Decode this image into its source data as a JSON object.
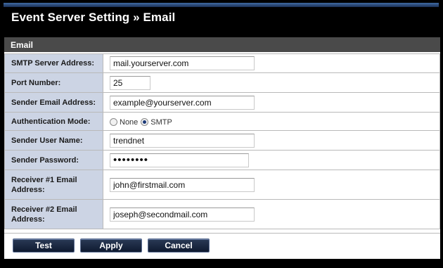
{
  "page": {
    "title": "Event Server Setting » Email"
  },
  "section": {
    "heading": "Email"
  },
  "fields": {
    "smtp_server": {
      "label": "SMTP Server Address:",
      "value": "mail.yourserver.com"
    },
    "port": {
      "label": "Port Number:",
      "value": "25"
    },
    "sender_email": {
      "label": "Sender Email Address:",
      "value": "example@yourserver.com"
    },
    "auth_mode": {
      "label": "Authentication Mode:",
      "options": [
        "None",
        "SMTP"
      ],
      "selected": "SMTP"
    },
    "sender_user": {
      "label": "Sender User Name:",
      "value": "trendnet"
    },
    "sender_password": {
      "label": "Sender Password:",
      "value": "••••••••"
    },
    "receiver1": {
      "label": "Receiver #1 Email Address:",
      "value": "john@firstmail.com"
    },
    "receiver2": {
      "label": "Receiver #2 Email Address:",
      "value": "joseph@secondmail.com"
    }
  },
  "buttons": {
    "test": "Test",
    "apply": "Apply",
    "cancel": "Cancel"
  },
  "colors": {
    "label_bg": "#ccd4e4",
    "section_bg": "#4a4a4a",
    "button_bg": "#1b2742"
  }
}
